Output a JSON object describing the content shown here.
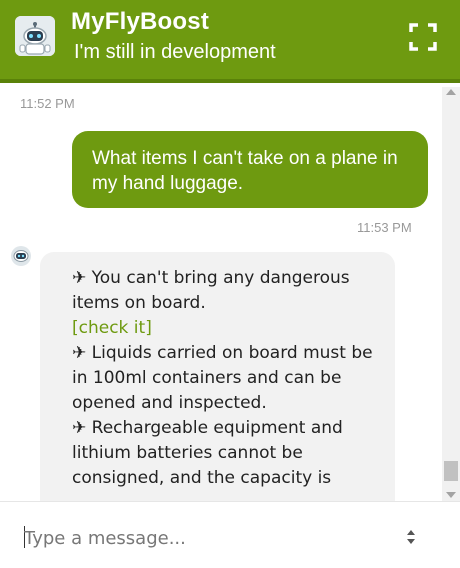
{
  "header": {
    "title": "MyFlyBoost",
    "subtitle": "I'm still in development",
    "avatar_icon": "robot-icon",
    "expand_icon": "expand-icon"
  },
  "conversation": {
    "first_timestamp": "11:52 PM",
    "user_message": "What items I can't take on a plane in my hand luggage.",
    "user_timestamp": "11:53 PM",
    "bot_icon": "robot-icon",
    "bot_reply": {
      "line1": "✈ You can't bring any dangerous items on board.",
      "link": "[check it]",
      "line2": "✈ Liquids carried on board must be in 100ml containers and can be opened and inspected.",
      "line3": "✈ Rechargeable equipment and lithium batteries cannot be consigned, and the capacity is"
    }
  },
  "composer": {
    "placeholder": "Type a message..."
  },
  "colors": {
    "brand": "#6e9a10",
    "bot_bubble": "#f2f2f2"
  }
}
